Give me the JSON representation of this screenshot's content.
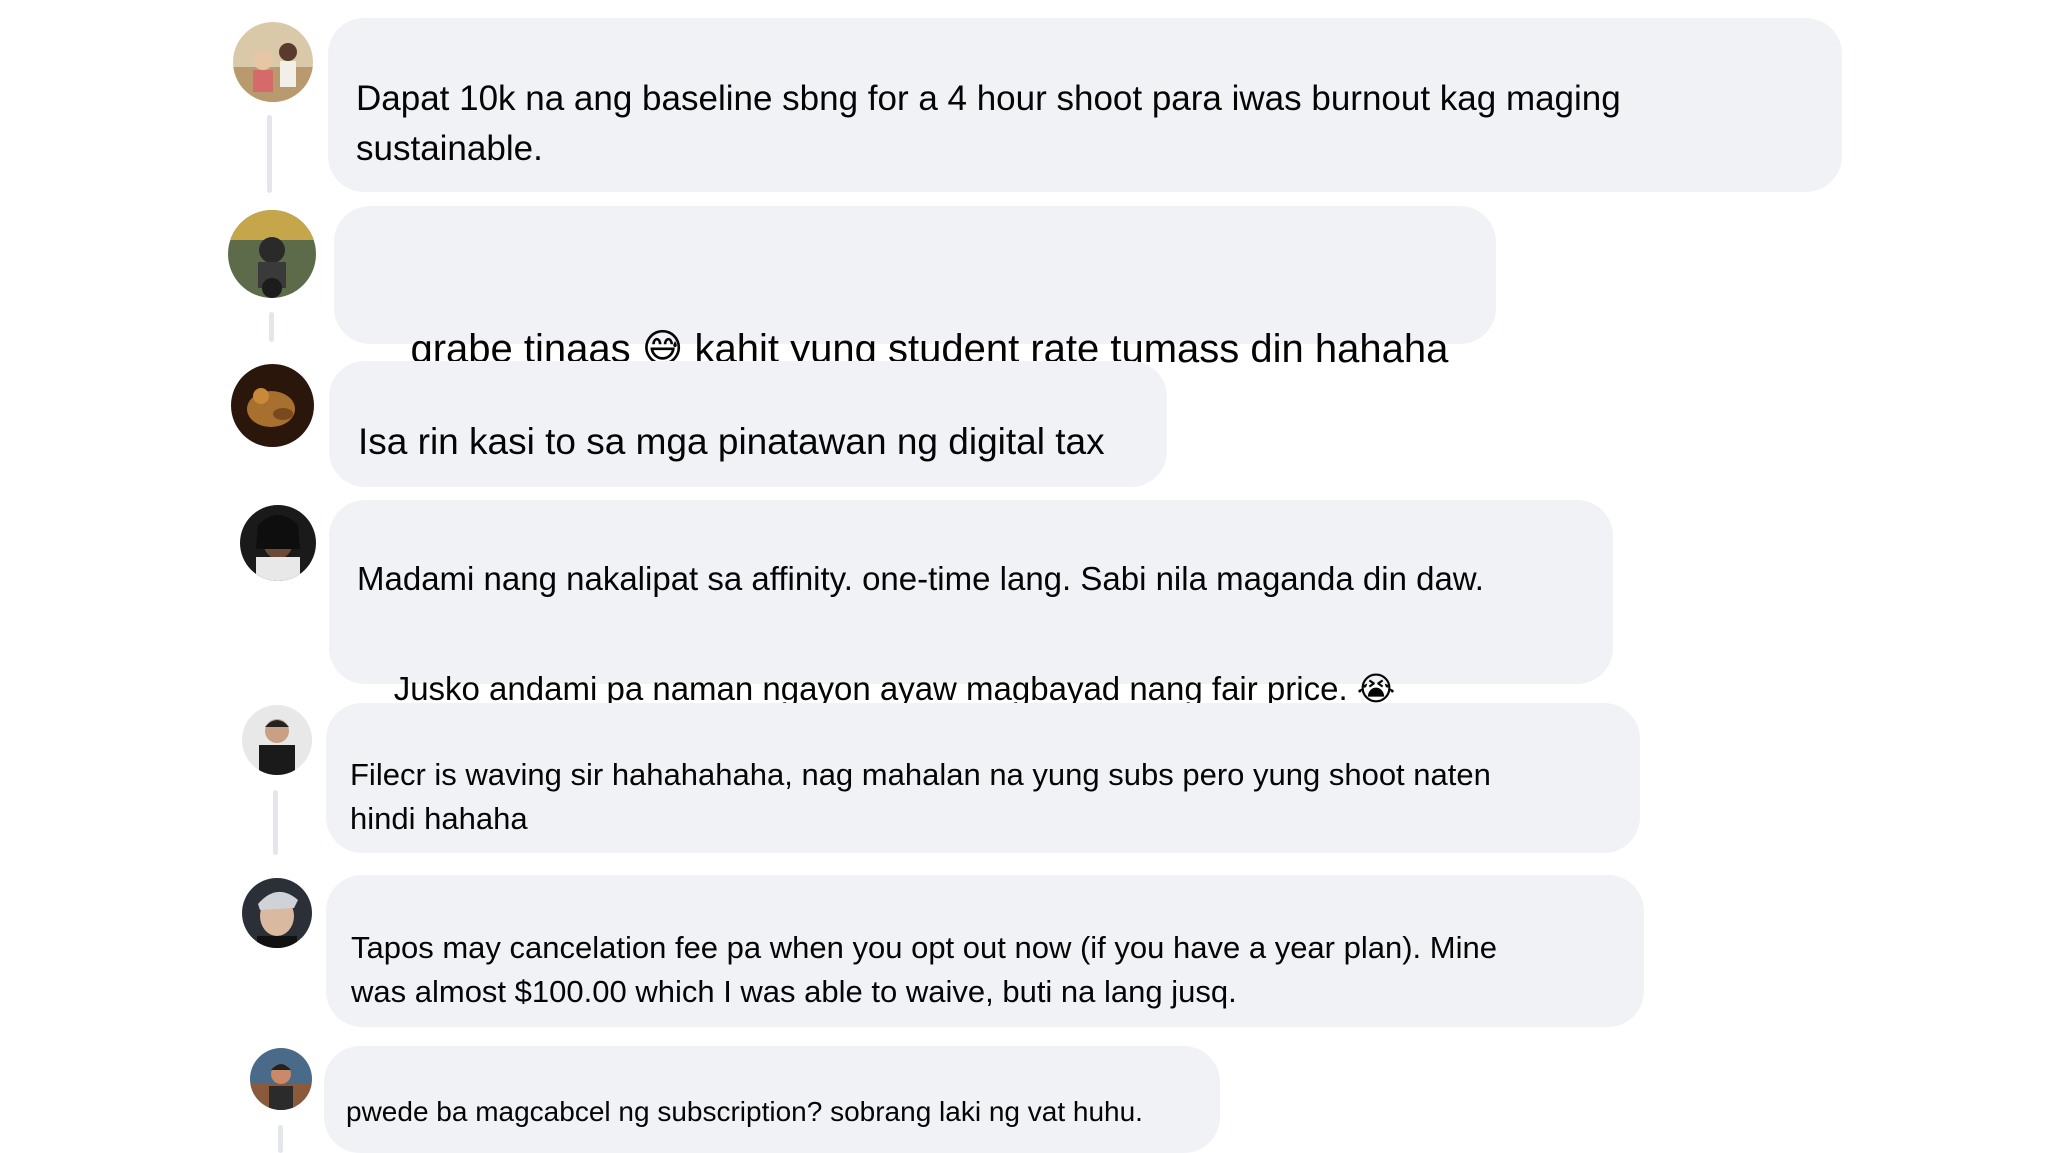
{
  "comments": [
    {
      "text": "Dapat 10k na ang baseline sbng for a 4 hour shoot para iwas burnout kag maging\nsustainable.",
      "avatar": "avatar-1-icon"
    },
    {
      "text_before": "grabe tinaas ",
      "emoji": "😅",
      "text_after": " kahit yung student rate tumass din hahaha",
      "avatar": "avatar-2-icon"
    },
    {
      "text": "Isa rin kasi to sa mga pinatawan ng digital tax",
      "avatar": "avatar-3-icon"
    },
    {
      "line1": "Madami nang nakalipat sa affinity. one-time lang. Sabi nila maganda din daw.",
      "line2": "Jusko andami pa naman ngayon ayaw magbayad nang fair price. ",
      "emoji": "😭",
      "avatar": "avatar-4-icon"
    },
    {
      "text": "Filecr is waving sir hahahahaha, nag mahalan na yung subs pero yung shoot naten\nhindi hahaha",
      "avatar": "avatar-5-icon"
    },
    {
      "text": "Tapos may cancelation fee pa when you opt out now (if you have a year plan). Mine\nwas almost $100.00 which I was able to waive, buti na lang jusq.",
      "avatar": "avatar-6-icon"
    },
    {
      "text": "pwede ba magcabcel ng subscription? sobrang laki ng vat huhu.",
      "avatar": "avatar-7-icon"
    }
  ],
  "colors": {
    "bubble": "#f0f2f5",
    "text": "#050505",
    "thread_line": "#e4e6eb"
  }
}
